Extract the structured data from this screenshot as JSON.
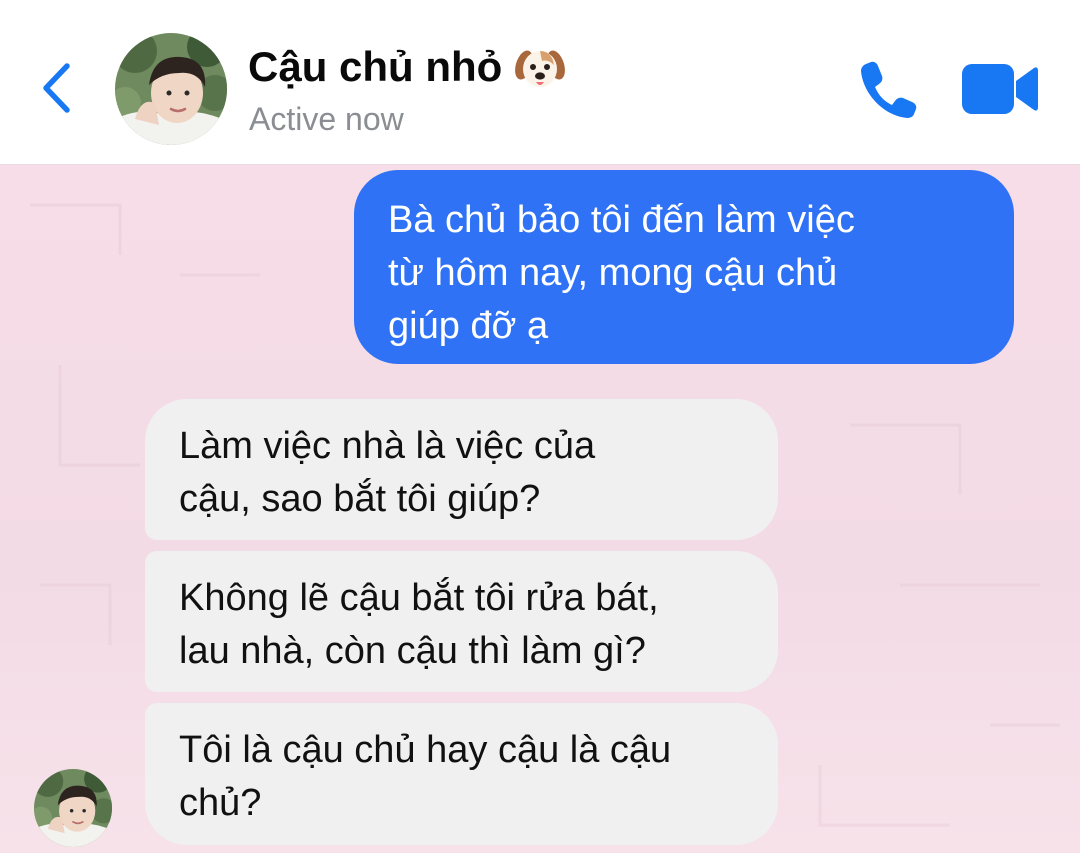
{
  "header": {
    "contact_name": "Cậu chủ nhỏ",
    "name_emoji": "dog-face-emoji",
    "presence": "Active now",
    "icons": {
      "back": "chevron-left-icon",
      "call": "phone-icon",
      "video": "video-camera-icon"
    },
    "accent_color": "#1877f2"
  },
  "messages": [
    {
      "direction": "outgoing",
      "text": "Bà chủ bảo tôi đến làm việc\ntừ hôm nay, mong cậu chủ\ngiúp đỡ ạ"
    },
    {
      "direction": "incoming",
      "text": "Làm việc nhà là việc của\ncậu, sao bắt tôi giúp?"
    },
    {
      "direction": "incoming",
      "text": "Không lẽ cậu bắt tôi rửa bát,\nlau nhà, còn cậu thì làm gì?"
    },
    {
      "direction": "incoming",
      "text": "Tôi là cậu chủ hay cậu là cậu\nchủ?"
    }
  ],
  "colors": {
    "outgoing_bubble": "#2f72f6",
    "incoming_bubble": "#f0f0f0",
    "chat_background": "#f5dde6"
  }
}
